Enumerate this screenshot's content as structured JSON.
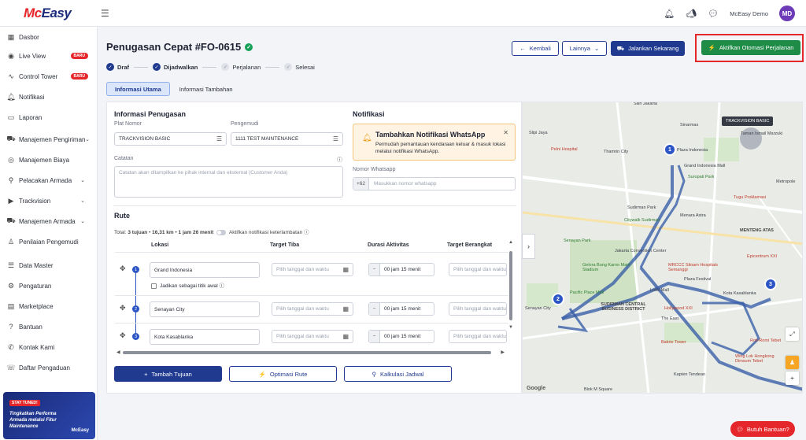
{
  "brand": {
    "logo_mc": "Mc",
    "logo_easy": "Easy"
  },
  "topbar": {
    "user_name": "McEasy Demo",
    "avatar_initials": "MD",
    "icons": [
      "bell-icon",
      "megaphone-icon",
      "chat-icon"
    ]
  },
  "sidebar": {
    "items": [
      {
        "label": "Dasbor",
        "icon": "grid-icon"
      },
      {
        "label": "Live View",
        "icon": "radar-icon",
        "badge": "BARU"
      },
      {
        "label": "Control Tower",
        "icon": "pulse-icon",
        "badge": "BARU"
      },
      {
        "label": "Notifikasi",
        "icon": "bell-icon"
      },
      {
        "label": "Laporan",
        "icon": "report-icon"
      },
      {
        "label": "Manajemen Pengiriman",
        "icon": "truck-icon",
        "chevron": true
      },
      {
        "label": "Manajemen Biaya",
        "icon": "money-icon"
      },
      {
        "label": "Pelacakan Armada",
        "icon": "route-icon",
        "chevron": true
      },
      {
        "label": "Trackvision",
        "icon": "camera-icon",
        "chevron": true
      },
      {
        "label": "Manajemen Armada",
        "icon": "fleet-icon",
        "chevron": true
      },
      {
        "label": "Penilaian Pengemudi",
        "icon": "driver-icon"
      },
      {
        "label": "Data Master",
        "icon": "database-icon"
      },
      {
        "label": "Pengaturan",
        "icon": "gear-icon"
      },
      {
        "label": "Marketplace",
        "icon": "store-icon"
      },
      {
        "label": "Bantuan",
        "icon": "help-icon"
      },
      {
        "label": "Kontak Kami",
        "icon": "phone-icon"
      },
      {
        "label": "Daftar Pengaduan",
        "icon": "complaint-icon"
      }
    ]
  },
  "promo": {
    "tag": "STAY TUNED!",
    "text": "Tingkatkan Performa Armada melalui Fitur Maintenance",
    "brand": "McEasy"
  },
  "header": {
    "title": "Penugasan Cepat #FO-0615",
    "back_label": "Kembali",
    "more_label": "Lainnya",
    "run_label": "Jalankan Sekarang",
    "auto_label": "Aktifkan Otomasi Perjalanan"
  },
  "steps": [
    {
      "label": "Draf",
      "done": true
    },
    {
      "label": "Dijadwalkan",
      "done": true
    },
    {
      "label": "Perjalanan",
      "done": false
    },
    {
      "label": "Selesai",
      "done": false
    }
  ],
  "tabs": {
    "main": "Informasi Utama",
    "extra": "Informasi Tambahan"
  },
  "info": {
    "title": "Informasi Penugasan",
    "plate_label": "Plat Nomor",
    "plate_value": "TRACKVISION BASIC",
    "driver_label": "Pengemudi",
    "driver_value": "1111 TEST MAINTENANCE",
    "note_label": "Catatan",
    "note_placeholder": "Catatan akan ditampilkan ke pihak internal dan eksternal (Customer Anda)"
  },
  "notif": {
    "title": "Notifikasi",
    "wa_title": "Tambahkan Notifikasi WhatsApp",
    "wa_desc": "Permudah pemantauan kendaraan keluar & masuk lokasi melalui notifikasi WhatsApp.",
    "wa_label": "Nomor Whatsapp",
    "wa_prefix": "+62",
    "wa_placeholder": "Masukkan nomor whatsapp"
  },
  "route": {
    "title": "Rute",
    "summary_prefix": "Total:",
    "summary_stops": "3 tujuan",
    "summary_dist": "16,31 km",
    "summary_time": "1 jam 26 menit",
    "late_toggle": "Aktifkan notifikasi keterlambatan",
    "columns": [
      "Lokasi",
      "Target Tiba",
      "Durasi Aktivitas",
      "Target Berangkat"
    ],
    "datetime_placeholder": "Pilih tanggal dan waktu",
    "start_point_label": "Jadikan sebagai titik awal",
    "rows": [
      {
        "num": "1",
        "location": "Grand Indonesia",
        "duration": "00 jam 15 menit"
      },
      {
        "num": "2",
        "location": "Senayan City",
        "duration": "00 jam 15 menit"
      },
      {
        "num": "3",
        "location": "Kota Kasablanka",
        "duration": "00 jam 15 menit"
      }
    ],
    "add_label": "Tambah Tujuan",
    "optimize_label": "Optimasi Rute",
    "schedule_label": "Kalkulasi Jadwal"
  },
  "map": {
    "tooltip": "TRACKVISION BASIC",
    "pins": [
      "1",
      "2",
      "3"
    ],
    "labels": [
      "Sinarmas",
      "Thamrin City",
      "Pelni Hospital",
      "Plaza Indonesia",
      "Grand Indonesia Mall",
      "Taman Ismail Marzuki",
      "Suropati Park",
      "Tugu Proklamasi",
      "Sudirman Park",
      "Citywalk Sudirman",
      "Menara Astra",
      "Senayan Park",
      "Jakarta Convention Center",
      "MENTENG ATAS",
      "Gelora Bung Karno Main Stadium",
      "MRCCC Siloam Hospitals Semanggi",
      "Plaza Festival",
      "Epicentrum XXI",
      "Pacific Place Mall",
      "Lotte Mall",
      "Kota Kasablanka",
      "Senayan City",
      "SUDIRMAN CENTRAL BUSINESS DISTRICT",
      "Hollywood XXI",
      "The East",
      "Bakrie Tower",
      "Roti Romi Tebet",
      "Wing Lok Hongkong Dimsum Tebet",
      "Blok M Square",
      "Metropole",
      "Silih Jakarta",
      "Slipi Jaya",
      "Google",
      "Kapten Tendean"
    ]
  },
  "help": {
    "label": "Butuh Bantuan?"
  }
}
